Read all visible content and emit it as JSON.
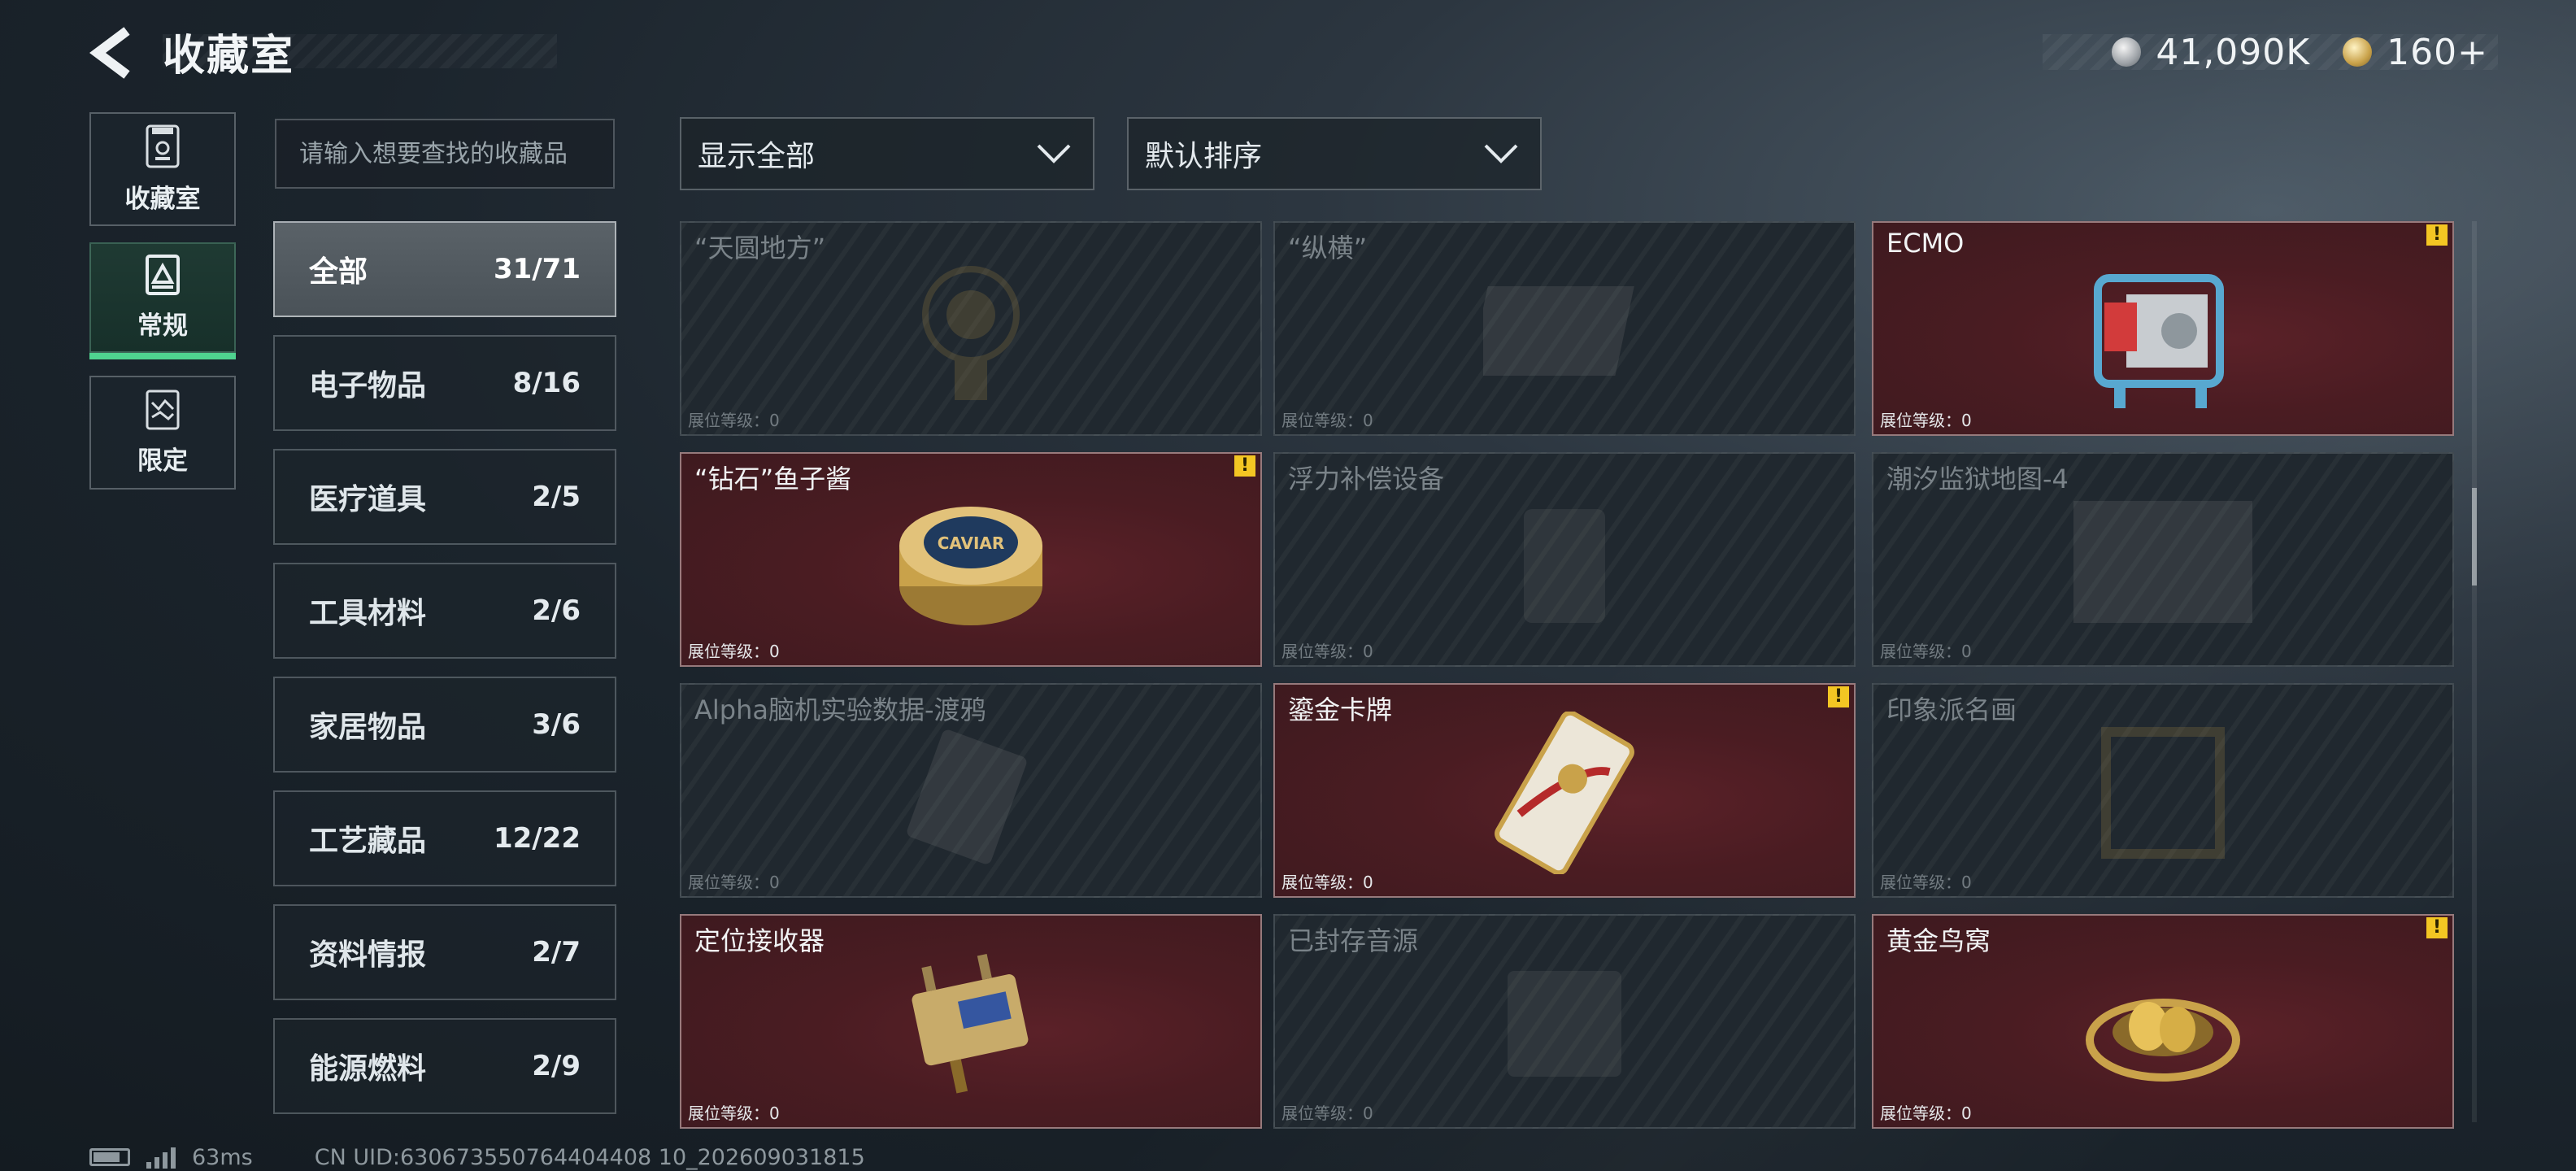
{
  "header": {
    "title": "收藏室",
    "currency": [
      {
        "icon": "silver-coin-icon",
        "value": "41,090K"
      },
      {
        "icon": "gold-coin-icon",
        "value": "160+"
      }
    ]
  },
  "side_nav": [
    {
      "label": "收藏室",
      "icon": "collection-room-icon",
      "active": false
    },
    {
      "label": "常规",
      "icon": "regular-card-icon",
      "active": true
    },
    {
      "label": "限定",
      "icon": "limited-card-icon",
      "active": false
    }
  ],
  "search": {
    "placeholder": "请输入想要查找的收藏品"
  },
  "categories": [
    {
      "name": "全部",
      "count": "31/71",
      "active": true
    },
    {
      "name": "电子物品",
      "count": "8/16"
    },
    {
      "name": "医疗道具",
      "count": "2/5"
    },
    {
      "name": "工具材料",
      "count": "2/6"
    },
    {
      "name": "家居物品",
      "count": "3/6"
    },
    {
      "name": "工艺藏品",
      "count": "12/22"
    },
    {
      "name": "资料情报",
      "count": "2/7"
    },
    {
      "name": "能源燃料",
      "count": "2/9"
    }
  ],
  "filters": {
    "show": "显示全部",
    "sort": "默认排序"
  },
  "items": [
    {
      "name": "“天圆地方”",
      "level": "展位等级：0",
      "owned": false,
      "alert": false,
      "art": "globe"
    },
    {
      "name": "“纵横”",
      "level": "展位等级：0",
      "owned": false,
      "alert": false,
      "art": "board"
    },
    {
      "name": "ECMO",
      "level": "展位等级：0",
      "owned": true,
      "alert": true,
      "art": "ecmo"
    },
    {
      "name": "“钻石”鱼子酱",
      "level": "展位等级：0",
      "owned": true,
      "alert": true,
      "art": "caviar",
      "art_text": "CAVIAR"
    },
    {
      "name": "浮力补偿设备",
      "level": "展位等级：0",
      "owned": false,
      "alert": false,
      "art": "vest"
    },
    {
      "name": "潮汐监狱地图-4",
      "level": "展位等级：0",
      "owned": false,
      "alert": false,
      "art": "map"
    },
    {
      "name": "Alpha脑机实验数据-渡鸦",
      "level": "展位等级：0",
      "owned": false,
      "alert": false,
      "art": "drive"
    },
    {
      "name": "鎏金卡牌",
      "level": "展位等级：0",
      "owned": true,
      "alert": true,
      "art": "card"
    },
    {
      "name": "印象派名画",
      "level": "展位等级：0",
      "owned": false,
      "alert": false,
      "art": "frame"
    },
    {
      "name": "定位接收器",
      "level": "展位等级：0",
      "owned": true,
      "alert": false,
      "art": "receiver"
    },
    {
      "name": "已封存音源",
      "level": "展位等级：0",
      "owned": false,
      "alert": false,
      "art": "box"
    },
    {
      "name": "黄金鸟窝",
      "level": "展位等级：0",
      "owned": true,
      "alert": true,
      "art": "nest"
    }
  ],
  "alert_mark": "!",
  "footer": {
    "ping": "63ms",
    "uid": "CN UID:630673550764404408 10_202609031815"
  }
}
